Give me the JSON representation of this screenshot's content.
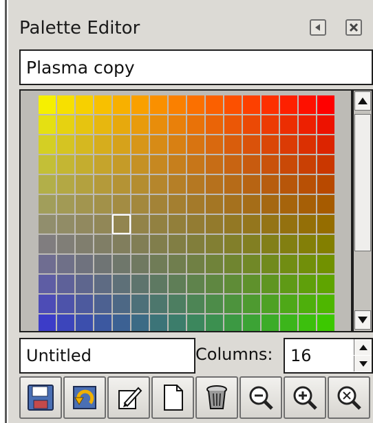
{
  "dockable": {
    "title": "Palette Editor"
  },
  "palette": {
    "name": "Plasma copy",
    "columns": 16,
    "visible_rows": 12,
    "selected_index": 100,
    "corner_colors": {
      "top_left": "#f6f000",
      "top_right": "#ff0000",
      "bottom_left": "#3c3cc8",
      "bottom_right": "#3cc800"
    }
  },
  "editor": {
    "color_name": "Untitled",
    "columns_label": "Columns:",
    "columns_value": "16"
  },
  "toolbar": {
    "buttons": [
      {
        "name": "save-palette-button",
        "icon": "floppy-disk-icon"
      },
      {
        "name": "revert-palette-button",
        "icon": "revert-icon"
      },
      {
        "name": "edit-color-button",
        "icon": "edit-icon"
      },
      {
        "name": "new-color-button",
        "icon": "new-page-icon"
      },
      {
        "name": "delete-color-button",
        "icon": "trash-icon"
      },
      {
        "name": "zoom-out-button",
        "icon": "zoom-out-icon"
      },
      {
        "name": "zoom-in-button",
        "icon": "zoom-in-icon"
      },
      {
        "name": "zoom-fit-button",
        "icon": "zoom-fit-icon"
      }
    ]
  }
}
